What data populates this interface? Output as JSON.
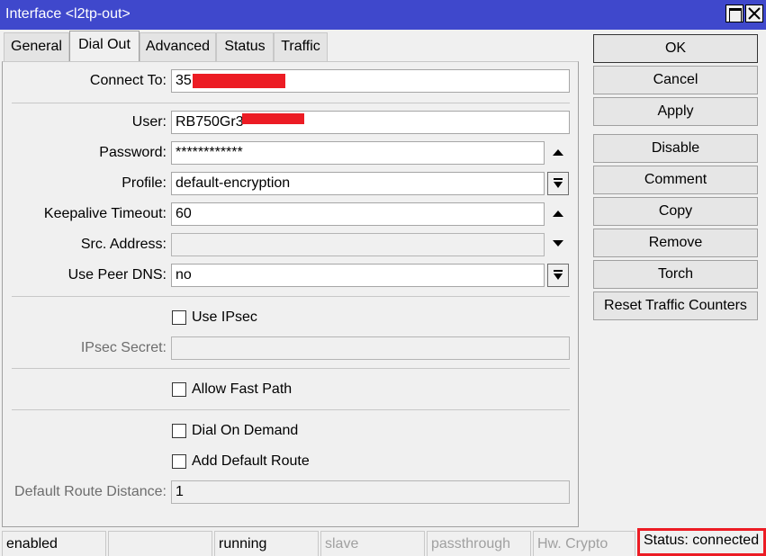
{
  "window": {
    "title": "Interface <l2tp-out>"
  },
  "tabs": [
    {
      "label": "General"
    },
    {
      "label": "Dial Out",
      "active": true
    },
    {
      "label": "Advanced"
    },
    {
      "label": "Status"
    },
    {
      "label": "Traffic"
    }
  ],
  "form": {
    "connect_to": {
      "label": "Connect To:",
      "value": "35"
    },
    "user": {
      "label": "User:",
      "value": "RB750Gr3"
    },
    "password": {
      "label": "Password:",
      "value": "************"
    },
    "profile": {
      "label": "Profile:",
      "value": "default-encryption"
    },
    "keepalive": {
      "label": "Keepalive Timeout:",
      "value": "60"
    },
    "src_address": {
      "label": "Src. Address:",
      "value": ""
    },
    "use_peer_dns": {
      "label": "Use Peer DNS:",
      "value": "no"
    },
    "use_ipsec": {
      "label": "Use IPsec",
      "checked": false
    },
    "ipsec_secret": {
      "label": "IPsec Secret:",
      "value": ""
    },
    "allow_fast_path": {
      "label": "Allow Fast Path",
      "checked": false
    },
    "dial_on_demand": {
      "label": "Dial On Demand",
      "checked": false
    },
    "add_default_route": {
      "label": "Add Default Route",
      "checked": false
    },
    "default_route_distance": {
      "label": "Default Route Distance:",
      "value": "1"
    }
  },
  "buttons": {
    "ok": "OK",
    "cancel": "Cancel",
    "apply": "Apply",
    "disable": "Disable",
    "comment": "Comment",
    "copy": "Copy",
    "remove": "Remove",
    "torch": "Torch",
    "reset_counters": "Reset Traffic Counters"
  },
  "statusbar": {
    "enabled": "enabled",
    "empty": "",
    "running": "running",
    "slave": "slave",
    "passthrough": "passthrough",
    "hw_crypto": "Hw. Crypto",
    "status": "Status: connected"
  },
  "colors": {
    "titlebar": "#3f48cc",
    "redaction": "#ec1c24",
    "highlight": "#ec1c24"
  }
}
